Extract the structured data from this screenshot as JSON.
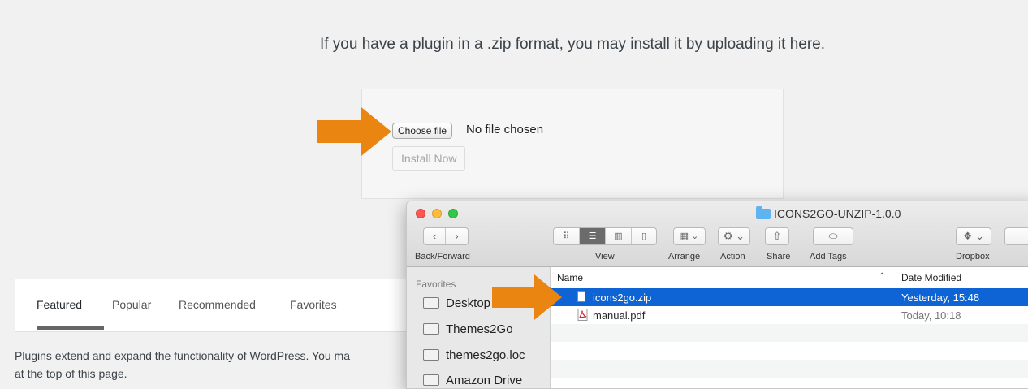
{
  "upload": {
    "instruction": "If you have a plugin in a .zip format, you may install it by uploading it here.",
    "choose_file_label": "Choose file",
    "no_file_text": "No file chosen",
    "install_label": "Install Now"
  },
  "tabs": {
    "items": [
      {
        "label": "Featured",
        "active": true
      },
      {
        "label": "Popular",
        "active": false
      },
      {
        "label": "Recommended",
        "active": false
      },
      {
        "label": "Favorites",
        "active": false
      }
    ]
  },
  "description": {
    "line1": "Plugins extend and expand the functionality of WordPress. You ma",
    "line2": "at the top of this page."
  },
  "finder": {
    "title": "ICONS2GO-UNZIP-1.0.0",
    "toolbar": {
      "back_forward_label": "Back/Forward",
      "view_label": "View",
      "arrange_label": "Arrange",
      "action_label": "Action",
      "share_label": "Share",
      "add_tags_label": "Add Tags",
      "dropbox_label": "Dropbox"
    },
    "sidebar": {
      "heading": "Favorites",
      "items": [
        "Desktop",
        "Themes2Go",
        "themes2go.loc",
        "Amazon Drive"
      ]
    },
    "columns": {
      "name": "Name",
      "date_modified": "Date Modified"
    },
    "files": [
      {
        "name": "icons2go.zip",
        "date": "Yesterday, 15:48",
        "selected": true
      },
      {
        "name": "manual.pdf",
        "date": "Today, 10:18",
        "selected": false
      }
    ]
  },
  "colors": {
    "arrow": "#ea8512",
    "selection": "#0e64d4"
  }
}
